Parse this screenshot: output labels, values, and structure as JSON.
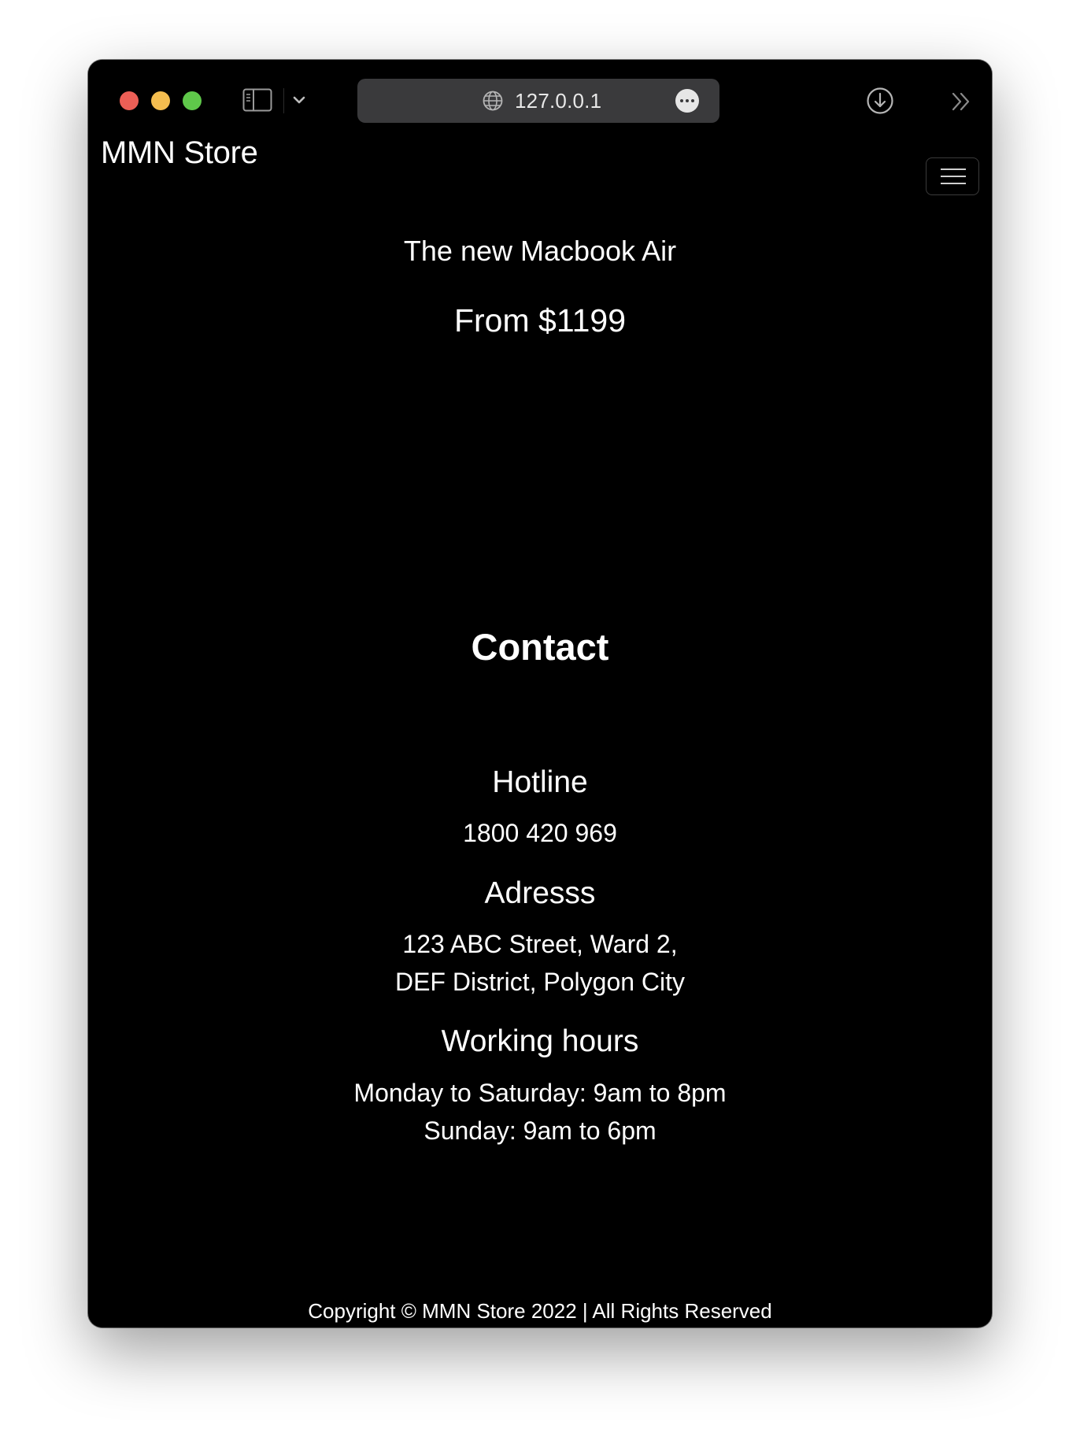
{
  "browser": {
    "url": "127.0.0.1"
  },
  "nav": {
    "brand": "MMN Store"
  },
  "hero": {
    "title": "The new Macbook Air",
    "price": "From $1199"
  },
  "contact": {
    "title": "Contact",
    "hotline": {
      "heading": "Hotline",
      "value": "1800 420 969"
    },
    "address": {
      "heading": "Adresss",
      "line1": "123 ABC Street, Ward 2,",
      "line2": "DEF District, Polygon City"
    },
    "hours": {
      "heading": "Working hours",
      "line1": "Monday to Saturday: 9am to 8pm",
      "line2": "Sunday: 9am to 6pm"
    }
  },
  "footer": {
    "copyright": "Copyright © MMN Store 2022 | All Rights Reserved"
  },
  "colors": {
    "page_bg": "#000000",
    "text": "#ffffff",
    "url_bar": "#3a3a3c",
    "close": "#ec5f56",
    "minimize": "#f4bd4f",
    "zoom": "#5fc84a"
  }
}
